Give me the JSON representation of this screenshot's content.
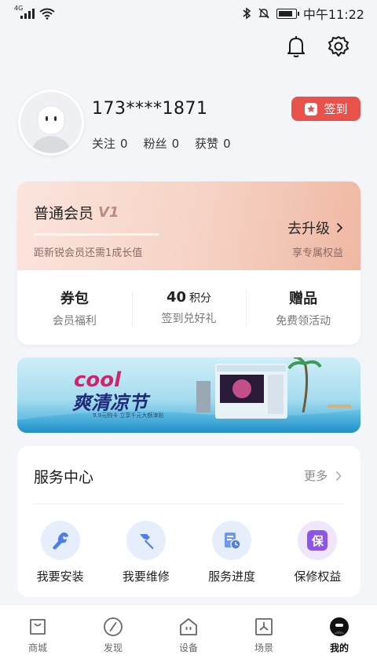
{
  "status_bar": {
    "network": "4G",
    "time": "中午11:22"
  },
  "header": {
    "bell_icon": "bell-icon",
    "settings_icon": "gear-icon"
  },
  "profile": {
    "phone": "173****1871",
    "stats": [
      {
        "label": "关注",
        "value": "0"
      },
      {
        "label": "粉丝",
        "value": "0"
      },
      {
        "label": "获赞",
        "value": "0"
      }
    ],
    "signin_label": "签到"
  },
  "member": {
    "level": "普通会员",
    "badge": "V1",
    "hint": "距新锐会员还需1成长值",
    "upgrade_label": "去升级",
    "perk_label": "享专属权益",
    "items": [
      {
        "title": "券包",
        "unit": "",
        "subtitle": "会员福利"
      },
      {
        "title": "40",
        "unit": "积分",
        "subtitle": "签到兑好礼"
      },
      {
        "title": "赠品",
        "unit": "",
        "subtitle": "免费领活动"
      }
    ]
  },
  "banner": {
    "headline_en": "cool",
    "headline_cn": "爽清凉节",
    "subline": "9.9元购卡 立享千元大额津贴"
  },
  "service": {
    "title": "服务中心",
    "more_label": "更多",
    "items": [
      {
        "label": "我要安装",
        "icon": "wrench-icon"
      },
      {
        "label": "我要维修",
        "icon": "hammer-icon"
      },
      {
        "label": "服务进度",
        "icon": "progress-document-icon"
      },
      {
        "label": "保修权益",
        "icon": "warranty-icon",
        "glyph": "保"
      }
    ]
  },
  "tabbar": {
    "items": [
      {
        "label": "商城",
        "icon": "shopping-bag-icon"
      },
      {
        "label": "发现",
        "icon": "compass-icon"
      },
      {
        "label": "设备",
        "icon": "house-icon"
      },
      {
        "label": "场景",
        "icon": "scene-icon"
      },
      {
        "label": "我的",
        "icon": "user-icon",
        "active": true
      }
    ]
  },
  "colors": {
    "accent_red": "#e8524a",
    "background": "#f4f5f8",
    "service_blue": "#4f7ee8",
    "service_purple": "#8c55e6"
  }
}
